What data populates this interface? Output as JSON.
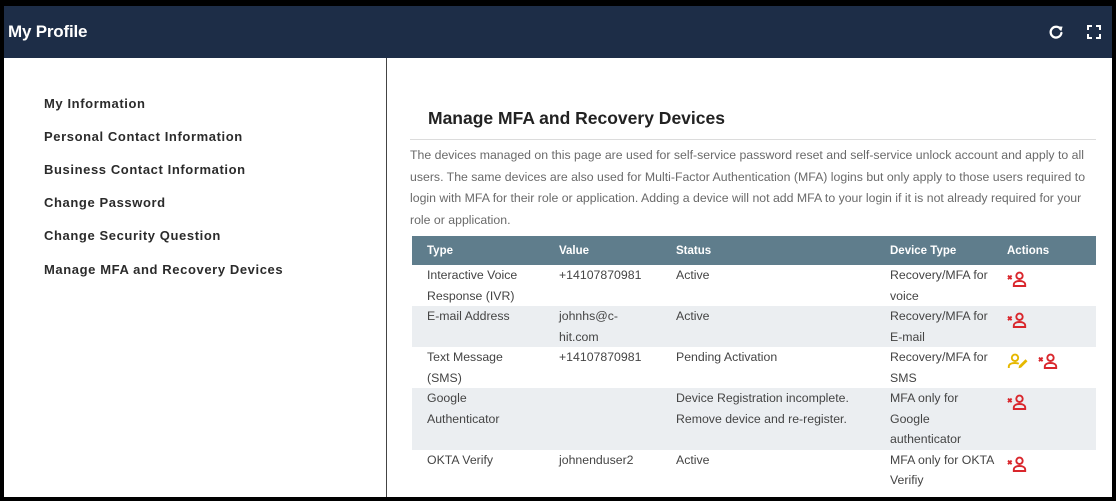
{
  "header": {
    "title": "My Profile",
    "refresh_icon": "refresh-icon",
    "fullscreen_icon": "expand-icon"
  },
  "sidebar": {
    "items": [
      {
        "label": "My Information"
      },
      {
        "label": "Personal Contact Information"
      },
      {
        "label": "Business Contact Information"
      },
      {
        "label": "Change Password"
      },
      {
        "label": "Change Security Question"
      },
      {
        "label": "Manage MFA and Recovery Devices"
      }
    ]
  },
  "main": {
    "heading": "Manage MFA and Recovery Devices",
    "description": "The devices managed on this page are used for self-service password reset and self-service unlock account and apply to all users. The same devices are also used for Multi-Factor Authentication (MFA) logins but only apply to those users required to login with MFA for their role or application. Adding a device will not add MFA to your login if it is not already required for your role or application."
  },
  "table": {
    "columns": [
      "Type",
      "Value",
      "Status",
      "Device Type",
      "Actions"
    ],
    "rows": [
      {
        "type": "Interactive Voice Response (IVR)",
        "value": "+14107870981",
        "status": "Active",
        "device_type": "Recovery/MFA for voice",
        "actions": [
          "remove-user-icon"
        ]
      },
      {
        "type": "E-mail Address",
        "value": "johnhs@c-hit.com",
        "status": "Active",
        "device_type": "Recovery/MFA for E-mail",
        "actions": [
          "remove-user-icon"
        ]
      },
      {
        "type": "Text Message (SMS)",
        "value": "+14107870981",
        "status": "Pending Activation",
        "device_type": "Recovery/MFA for SMS",
        "actions": [
          "edit-user-icon",
          "remove-user-icon"
        ]
      },
      {
        "type": "Google Authenticator",
        "value": "",
        "status": "Device Registration incomplete. Remove device and re-register.",
        "device_type": "MFA only for Google authenticator",
        "actions": [
          "remove-user-icon"
        ]
      },
      {
        "type": "OKTA Verify",
        "value": "johnenduser2",
        "status": "Active",
        "device_type": "MFA only for OKTA Verifiy",
        "actions": [
          "remove-user-icon"
        ]
      }
    ]
  },
  "colors": {
    "header_bg": "#1d2d47",
    "table_header_bg": "#5f7d8c",
    "remove_icon": "#d9262c",
    "edit_icon": "#e6b800"
  }
}
